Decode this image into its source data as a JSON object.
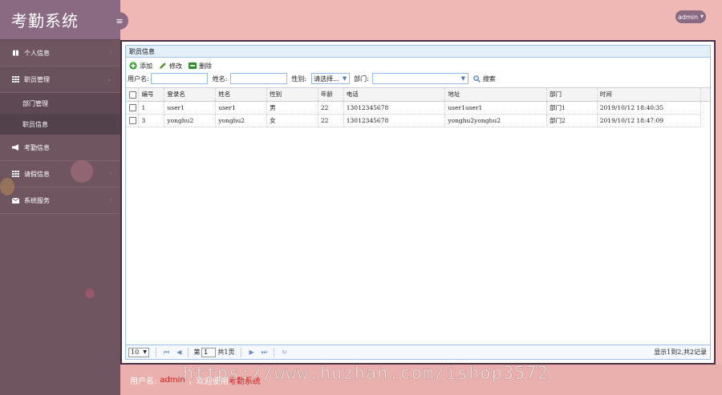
{
  "app": {
    "title": "考勤系统",
    "toggle_icon": "menu-icon"
  },
  "topbar": {
    "user_button": "admin"
  },
  "sidebar": {
    "items": [
      {
        "label": "个人信息",
        "icon": "book-icon"
      },
      {
        "label": "职员管理",
        "icon": "grid-icon",
        "subitems": [
          {
            "label": "部门管理"
          },
          {
            "label": "职员信息"
          }
        ]
      },
      {
        "label": "考勤信息",
        "icon": "megaphone-icon"
      },
      {
        "label": "请假信息",
        "icon": "grid-icon"
      },
      {
        "label": "系统服务",
        "icon": "envelope-icon"
      }
    ]
  },
  "panel": {
    "title": "职员信息",
    "toolbar": {
      "add": "添加",
      "edit": "修改",
      "delete": "删除"
    },
    "search": {
      "username_label": "用户名:",
      "name_label": "姓名:",
      "gender_label": "性别:",
      "gender_value": "请选择...",
      "dept_label": "部门:",
      "search_button": "搜索"
    },
    "table": {
      "columns": [
        "编号",
        "登录名",
        "姓名",
        "性别",
        "年龄",
        "电话",
        "地址",
        "部门",
        "时间"
      ],
      "rows": [
        [
          "1",
          "user1",
          "user1",
          "男",
          "22",
          "13012345678",
          "user1user1",
          "部门1",
          "2019/10/12 18:40:35"
        ],
        [
          "3",
          "yonghu2",
          "yonghu2",
          "女",
          "22",
          "13012345678",
          "yonghu2yonghu2",
          "部门2",
          "2019/10/12 18:47:09"
        ]
      ]
    },
    "pager": {
      "page_size": "10",
      "page_prefix": "第",
      "page_value": "1",
      "page_total": "共1页",
      "info": "显示1到2,共2记录"
    }
  },
  "footer": {
    "label": "用户名:",
    "user": "admin",
    "welcome": "，欢迎使用",
    "system": "考勤系统"
  },
  "watermark": "https://www.huzhan.com/ishop3572",
  "colors": {
    "sidebar": "#6e5560",
    "brand": "#8a6a82",
    "accent": "#f0b8b5",
    "link_red": "#d61c1c"
  }
}
